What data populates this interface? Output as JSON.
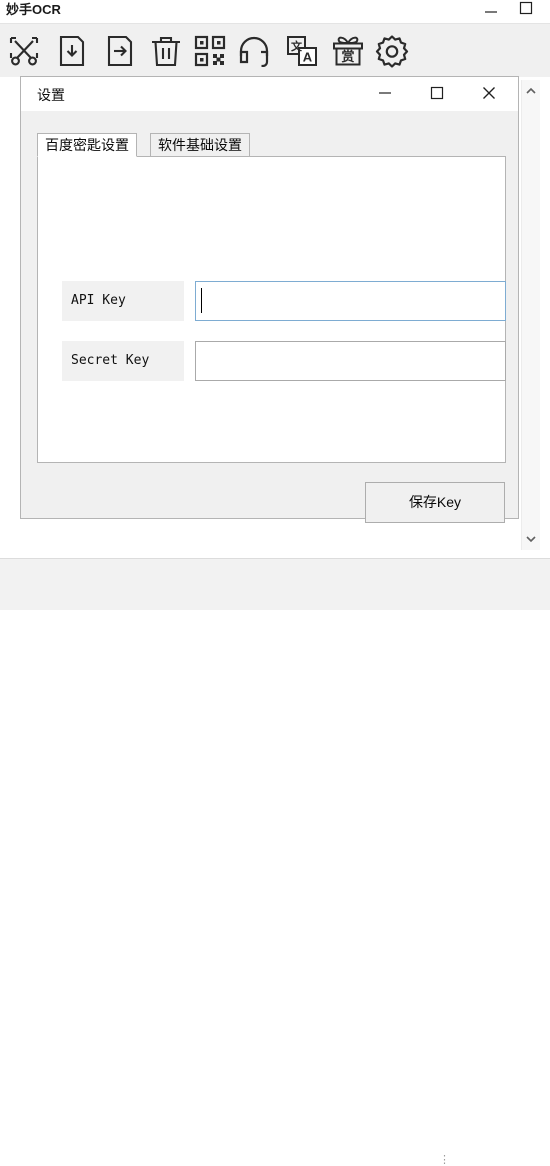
{
  "main_window": {
    "title": "妙手OCR",
    "controls": [
      {
        "name": "minimize-button",
        "glyph": "minimize-icon"
      },
      {
        "name": "maximize-button",
        "glyph": "maximize-icon"
      },
      {
        "name": "close-button",
        "glyph": "close-icon"
      }
    ],
    "toolbar": {
      "items": [
        {
          "icon": "screenshot-scissors-icon",
          "label": "截图"
        },
        {
          "icon": "import-file-icon",
          "label": "导入"
        },
        {
          "icon": "export-file-icon",
          "label": "导出"
        },
        {
          "icon": "trash-icon",
          "label": "删除"
        },
        {
          "icon": "qr-code-icon",
          "label": "二维码"
        },
        {
          "icon": "headphones-icon",
          "label": "客服"
        },
        {
          "icon": "translate-icon",
          "label": "翻译"
        },
        {
          "icon": "gift-reward-icon",
          "label": "赏"
        },
        {
          "icon": "gear-settings-icon",
          "label": "设置"
        }
      ]
    }
  },
  "dialog": {
    "title": "设置",
    "controls": [
      {
        "name": "minimize-button",
        "glyph": "minimize-icon"
      },
      {
        "name": "maximize-button",
        "glyph": "maximize-icon"
      },
      {
        "name": "close-button",
        "glyph": "close-icon"
      }
    ],
    "tabs": [
      {
        "label": "百度密匙设置",
        "active": true
      },
      {
        "label": "软件基础设置",
        "active": false
      }
    ],
    "form": {
      "api_key": {
        "label": "API Key",
        "value": "",
        "placeholder": "",
        "focused": true
      },
      "secret_key": {
        "label": "Secret Key",
        "value": "",
        "placeholder": "",
        "focused": false
      },
      "save_button_label": "保存Key"
    }
  },
  "scrollbar": {
    "up_arrow": "chevron-up-icon",
    "down_arrow": "chevron-down-icon"
  },
  "status": {
    "dots": "⋮"
  },
  "colors": {
    "focus_border": "#7eacd2",
    "idle_border": "#aaaaaa",
    "panel_bg": "#f0f0f0",
    "label_bg": "#f1f1f1",
    "window_bg": "#ffffff"
  }
}
